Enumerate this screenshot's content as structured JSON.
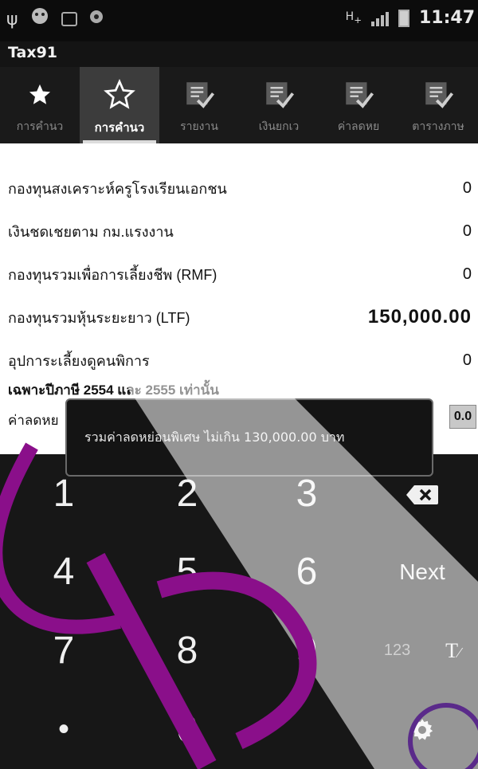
{
  "status_bar": {
    "time": "11:47",
    "icons": [
      "usb-icon",
      "android-icon",
      "sd-card-icon",
      "settings-icon",
      "h-plus-icon",
      "signal-icon",
      "battery-icon"
    ]
  },
  "app": {
    "title": "Tax91"
  },
  "tabs": [
    {
      "label": "การคำนว",
      "icon": "star-icon",
      "active": false
    },
    {
      "label": "การคำนว",
      "icon": "star-icon",
      "active": true
    },
    {
      "label": "รายงาน",
      "icon": "checklist-icon",
      "active": false
    },
    {
      "label": "เงินยกเว",
      "icon": "checklist-icon",
      "active": false
    },
    {
      "label": "ค่าลดหย",
      "icon": "checklist-icon",
      "active": false
    },
    {
      "label": "ตารางภาษ",
      "icon": "checklist-icon",
      "active": false
    }
  ],
  "rows": [
    {
      "label": "กองทุนสงเคราะห์ครูโรงเรียนเอกชน",
      "value": "0"
    },
    {
      "label": "เงินชดเชยตาม กม.แรงงาน",
      "value": "0"
    },
    {
      "label": "กองทุนรวมเพื่อการเลี้ยงชีพ (RMF)",
      "value": "0"
    },
    {
      "label": "กองทุนรวมหุ้นระยะยาว (LTF)",
      "value": "150,000.00"
    },
    {
      "label": "อุปการะเลี้ยงดูคนพิการ",
      "value": "0"
    }
  ],
  "note": "เฉพาะปีภาษี 2554 และ 2555 เท่านั้น",
  "field": {
    "label": "ค่าลดหย",
    "value": "0.0"
  },
  "toast": {
    "message": "รวมค่าลดหย่อนพิเศษ ไม่เกิน 130,000.00 บาท"
  },
  "keypad": {
    "keys": [
      "1",
      "2",
      "3",
      "4",
      "5",
      "6",
      "Next",
      "7",
      "8",
      "9",
      "123",
      "T",
      "•",
      "0"
    ],
    "next_label": "Next",
    "mode_label": "123"
  },
  "colors": {
    "status_bar_bg": "#0c0c0c",
    "tab_bar_bg": "#1a1a1a",
    "tab_active_bg": "#3c3c3c",
    "keypad_bg": "#171717",
    "watermark_purple": "#8a0f8a"
  }
}
